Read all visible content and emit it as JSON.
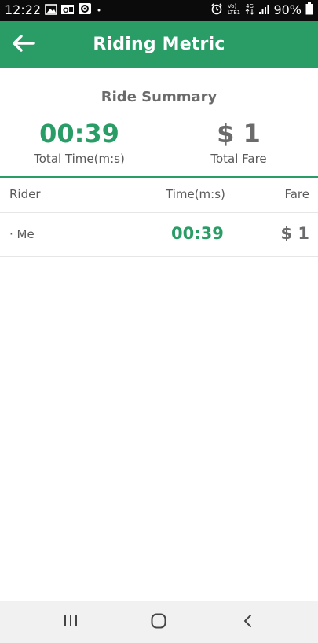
{
  "status_bar": {
    "time": "12:22",
    "battery": "90%",
    "icons": [
      "gallery-icon",
      "outlook-icon",
      "settings-icon",
      "dot-icon",
      "alarm-icon",
      "volte-icon",
      "4g-icon",
      "signal-icon",
      "battery-icon"
    ]
  },
  "app_bar": {
    "title": "Riding Metric",
    "back_icon": "arrow-left-icon",
    "color": "#2a9d66"
  },
  "summary": {
    "heading": "Ride Summary",
    "total_time_value": "00:39",
    "total_time_label": "Total Time(m:s)",
    "total_fare_value": "$ 1",
    "total_fare_label": "Total Fare"
  },
  "table": {
    "headers": {
      "rider": "Rider",
      "time": "Time(m:s)",
      "fare": "Fare"
    },
    "rows": [
      {
        "rider": "· Me",
        "time": "00:39",
        "fare": "$ 1"
      }
    ]
  },
  "nav_bar": {
    "buttons": [
      "recents-icon",
      "home-icon",
      "back-icon"
    ]
  },
  "colors": {
    "accent": "#2a9d66",
    "muted_text": "#6b6b6b"
  }
}
